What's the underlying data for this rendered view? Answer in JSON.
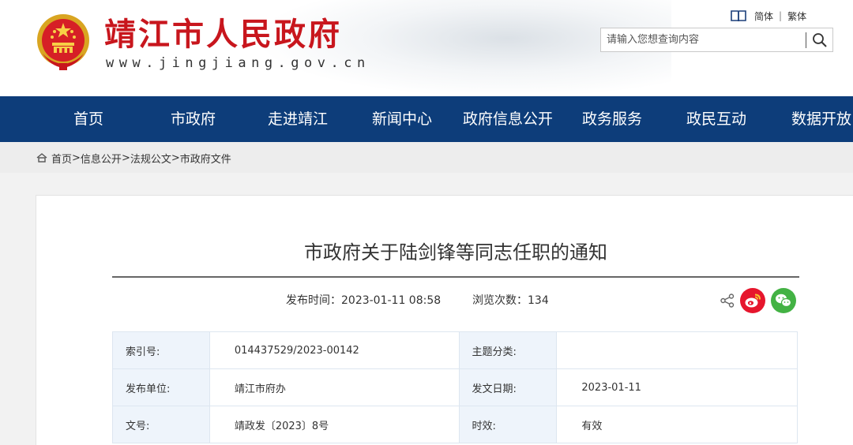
{
  "header": {
    "site_title": "靖江市人民政府",
    "site_url": "www.jingjiang.gov.cn",
    "lang_simplified": "简体",
    "lang_separator": "|",
    "lang_traditional": "繁体",
    "search_placeholder": "请输入您想查询内容"
  },
  "nav": {
    "items": [
      {
        "label": "首页"
      },
      {
        "label": "市政府"
      },
      {
        "label": "走进靖江"
      },
      {
        "label": "新闻中心"
      },
      {
        "label": "政府信息公开"
      },
      {
        "label": "政务服务"
      },
      {
        "label": "政民互动"
      },
      {
        "label": "数据开放"
      }
    ]
  },
  "breadcrumb": {
    "items": [
      "首页",
      "信息公开",
      "法规公文",
      "市政府文件"
    ],
    "separator": ">"
  },
  "article": {
    "title": "市政府关于陆剑锋等同志任职的通知",
    "publish_label": "发布时间：",
    "publish_time": "2023-01-11 08:58",
    "views_label": "浏览次数：",
    "views": "134"
  },
  "info_table": {
    "rows": [
      {
        "k1": "索引号:",
        "v1": "014437529/2023-00142",
        "k2": "主题分类:",
        "v2": ""
      },
      {
        "k1": "发布单位:",
        "v1": "靖江市府办",
        "k2": "发文日期:",
        "v2": "2023-01-11"
      },
      {
        "k1": "文号:",
        "v1": "靖政发〔2023〕8号",
        "k2": "时效:",
        "v2": "有效"
      }
    ]
  },
  "colors": {
    "nav_bg": "#0d3d7a",
    "title_red": "#c8161d",
    "weibo_red": "#e6162d",
    "wechat_green": "#43b244"
  }
}
